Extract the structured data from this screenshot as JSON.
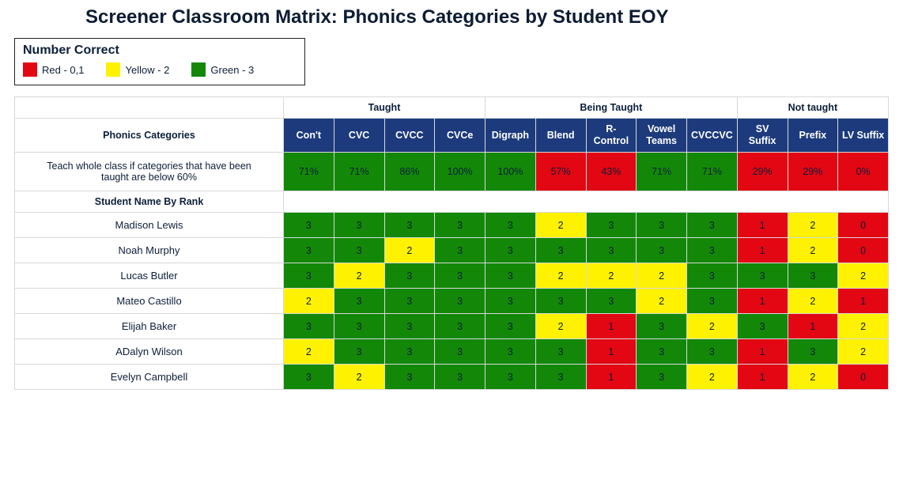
{
  "title": "Screener Classroom Matrix: Phonics Categories by Student EOY",
  "legend": {
    "title": "Number Correct",
    "red": "Red - 0,1",
    "yellow": "Yellow - 2",
    "green": "Green - 3"
  },
  "groups": {
    "g1": "Taught",
    "g2": "Being Taught",
    "g3": "Not taught"
  },
  "rowlabels": {
    "phonics": "Phonics Categories",
    "instruction": "Teach whole class if categories that have been taught are below 60%",
    "byrank": "Student Name By Rank"
  },
  "cats": {
    "c0": "Con't",
    "c1": "CVC",
    "c2": "CVCC",
    "c3": "CVCe",
    "c4": "Digraph",
    "c5": "Blend",
    "c6": "R-Control",
    "c7": "Vowel Teams",
    "c8": "CVCCVC",
    "c9": "SV Suffix",
    "c10": "Prefix",
    "c11": "LV Suffix"
  },
  "pct": {
    "c0": "71%",
    "c1": "71%",
    "c2": "86%",
    "c3": "100%",
    "c4": "100%",
    "c5": "57%",
    "c6": "43%",
    "c7": "71%",
    "c8": "71%",
    "c9": "29%",
    "c10": "29%",
    "c11": "0%"
  },
  "students": {
    "s0": {
      "name": "Madison Lewis",
      "v": [
        "3",
        "3",
        "3",
        "3",
        "3",
        "2",
        "3",
        "3",
        "3",
        "1",
        "2",
        "0"
      ]
    },
    "s1": {
      "name": "Noah Murphy",
      "v": [
        "3",
        "3",
        "2",
        "3",
        "3",
        "3",
        "3",
        "3",
        "3",
        "1",
        "2",
        "0"
      ]
    },
    "s2": {
      "name": "Lucas Butler",
      "v": [
        "3",
        "2",
        "3",
        "3",
        "3",
        "2",
        "2",
        "2",
        "3",
        "3",
        "3",
        "2"
      ]
    },
    "s3": {
      "name": "Mateo Castillo",
      "v": [
        "2",
        "3",
        "3",
        "3",
        "3",
        "3",
        "3",
        "2",
        "3",
        "1",
        "2",
        "1"
      ]
    },
    "s4": {
      "name": "Elijah Baker",
      "v": [
        "3",
        "3",
        "3",
        "3",
        "3",
        "2",
        "1",
        "3",
        "2",
        "3",
        "1",
        "2"
      ]
    },
    "s5": {
      "name": "ADalyn Wilson",
      "v": [
        "2",
        "3",
        "3",
        "3",
        "3",
        "3",
        "1",
        "3",
        "3",
        "1",
        "3",
        "2"
      ]
    },
    "s6": {
      "name": "Evelyn Campbell",
      "v": [
        "3",
        "2",
        "3",
        "3",
        "3",
        "3",
        "1",
        "3",
        "2",
        "1",
        "2",
        "0"
      ]
    }
  },
  "chart_data": {
    "type": "table",
    "title": "Screener Classroom Matrix: Phonics Categories by Student EOY",
    "legend": {
      "red": [
        0,
        1
      ],
      "yellow": [
        2
      ],
      "green": [
        3
      ]
    },
    "groups": [
      {
        "name": "Taught",
        "categories": [
          "Con't",
          "CVC",
          "CVCC",
          "CVCe"
        ]
      },
      {
        "name": "Being Taught",
        "categories": [
          "Digraph",
          "Blend",
          "R-Control",
          "Vowel Teams",
          "CVCCVC"
        ]
      },
      {
        "name": "Not taught",
        "categories": [
          "SV Suffix",
          "Prefix",
          "LV Suffix"
        ]
      }
    ],
    "categories": [
      "Con't",
      "CVC",
      "CVCC",
      "CVCe",
      "Digraph",
      "Blend",
      "R-Control",
      "Vowel Teams",
      "CVCCVC",
      "SV Suffix",
      "Prefix",
      "LV Suffix"
    ],
    "class_percent": [
      71,
      71,
      86,
      100,
      100,
      57,
      43,
      71,
      71,
      29,
      29,
      0
    ],
    "class_percent_note": "Teach whole class if categories that have been taught are below 60%",
    "students": [
      {
        "name": "Madison Lewis",
        "scores": [
          3,
          3,
          3,
          3,
          3,
          2,
          3,
          3,
          3,
          1,
          2,
          0
        ]
      },
      {
        "name": "Noah Murphy",
        "scores": [
          3,
          3,
          2,
          3,
          3,
          3,
          3,
          3,
          3,
          1,
          2,
          0
        ]
      },
      {
        "name": "Lucas Butler",
        "scores": [
          3,
          2,
          3,
          3,
          3,
          2,
          2,
          2,
          3,
          3,
          3,
          2
        ]
      },
      {
        "name": "Mateo Castillo",
        "scores": [
          2,
          3,
          3,
          3,
          3,
          3,
          3,
          2,
          3,
          1,
          2,
          1
        ]
      },
      {
        "name": "Elijah Baker",
        "scores": [
          3,
          3,
          3,
          3,
          3,
          2,
          1,
          3,
          2,
          3,
          1,
          2
        ]
      },
      {
        "name": "ADalyn Wilson",
        "scores": [
          2,
          3,
          3,
          3,
          3,
          3,
          1,
          3,
          3,
          1,
          3,
          2
        ]
      },
      {
        "name": "Evelyn Campbell",
        "scores": [
          3,
          2,
          3,
          3,
          3,
          3,
          1,
          3,
          2,
          1,
          2,
          0
        ]
      }
    ]
  }
}
